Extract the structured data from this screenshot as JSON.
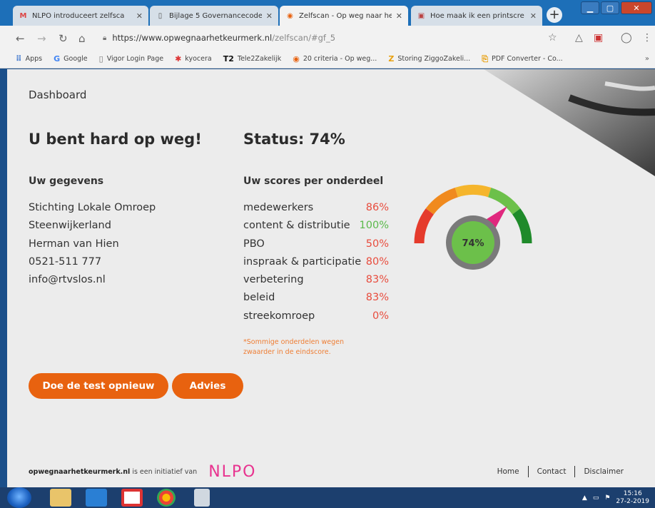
{
  "tabs": [
    {
      "label": "NLPO introduceert zelfsca",
      "favicon": "M",
      "active": false
    },
    {
      "label": "Bijlage 5 Governancecode",
      "favicon": "doc",
      "active": false
    },
    {
      "label": "Zelfscan - Op weg naar he",
      "favicon": "target",
      "active": true
    },
    {
      "label": "Hoe maak ik een printscre",
      "favicon": "img",
      "active": false
    }
  ],
  "address": {
    "host": "https://www.opwegnaarhetkeurmerk.nl",
    "path": "/zelfscan/#gf_5"
  },
  "bookmarks": [
    {
      "label": "Apps"
    },
    {
      "label": "Google"
    },
    {
      "label": "Vigor Login Page"
    },
    {
      "label": "kyocera"
    },
    {
      "label": "Tele2Zakelijk"
    },
    {
      "label": "20 criteria - Op weg..."
    },
    {
      "label": "Storing ZiggoZakeli..."
    },
    {
      "label": "PDF Converter - Co..."
    }
  ],
  "page": {
    "dashboard": "Dashboard",
    "headline": "U bent hard op weg!",
    "status": "Status: 74%",
    "gegevens_title": "Uw gegevens",
    "gegevens": [
      "Stichting Lokale Omroep",
      "Steenwijkerland",
      "Herman van Hien",
      "0521-511 777",
      "info@rtvslos.nl"
    ],
    "scores_title": "Uw scores per onderdeel",
    "scores": [
      {
        "label": "medewerkers",
        "value": "86%",
        "color": "#e84c3d"
      },
      {
        "label": "content & distributie",
        "value": "100%",
        "color": "#5ab94a"
      },
      {
        "label": "PBO",
        "value": "50%",
        "color": "#e84c3d"
      },
      {
        "label": "inspraak & participatie",
        "value": "80%",
        "color": "#e84c3d"
      },
      {
        "label": "verbetering",
        "value": "83%",
        "color": "#e84c3d"
      },
      {
        "label": "beleid",
        "value": "83%",
        "color": "#e84c3d"
      },
      {
        "label": "streekomroep",
        "value": "0%",
        "color": "#e84c3d"
      }
    ],
    "note": "*Sommige onderdelen wegen zwaarder in de eindscore.",
    "gauge": {
      "value": 0.74,
      "label": "74%"
    },
    "btn_retest": "Doe de test opnieuw",
    "btn_advies": "Advies",
    "footer_site": "opwegnaarhetkeurmerk.nl",
    "footer_text": " is een initiatief van",
    "footer_logo": "NLPO",
    "footer_links": [
      "Home",
      "Contact",
      "Disclaimer"
    ]
  },
  "taskbar": {
    "time": "15:16",
    "date": "27-2-2019"
  },
  "colors": {
    "accent": "#e8620f",
    "pink": "#e8338f",
    "good": "#5ab94a",
    "bad": "#e84c3d"
  }
}
